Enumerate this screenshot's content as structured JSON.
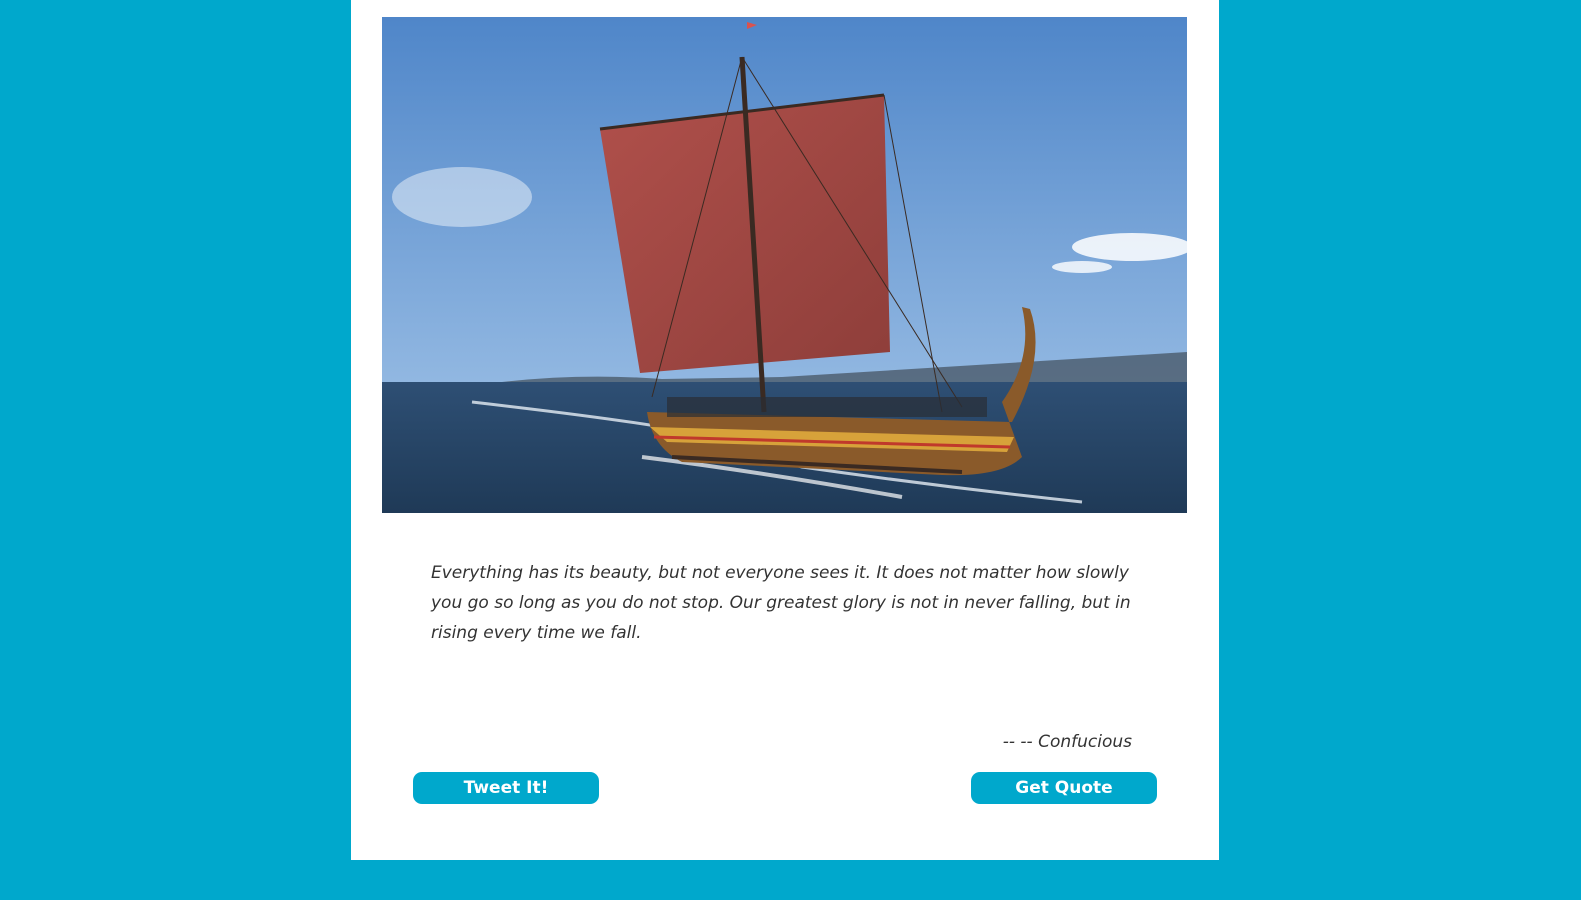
{
  "quote": {
    "text": "Everything has its beauty, but not everyone sees it. It does not matter how slowly you go so long as you do not stop. Our greatest glory is not in never falling, but in rising every time we fall.",
    "author": "-- -- Confucious"
  },
  "buttons": {
    "tweet_label": "Tweet It!",
    "get_quote_label": "Get Quote"
  },
  "image": {
    "subject": "viking-longship-photo"
  },
  "colors": {
    "page_background": "#00a8cc",
    "card_background": "#ffffff",
    "button_background": "#00a8cc",
    "button_text": "#ffffff",
    "quote_text": "#333333"
  }
}
